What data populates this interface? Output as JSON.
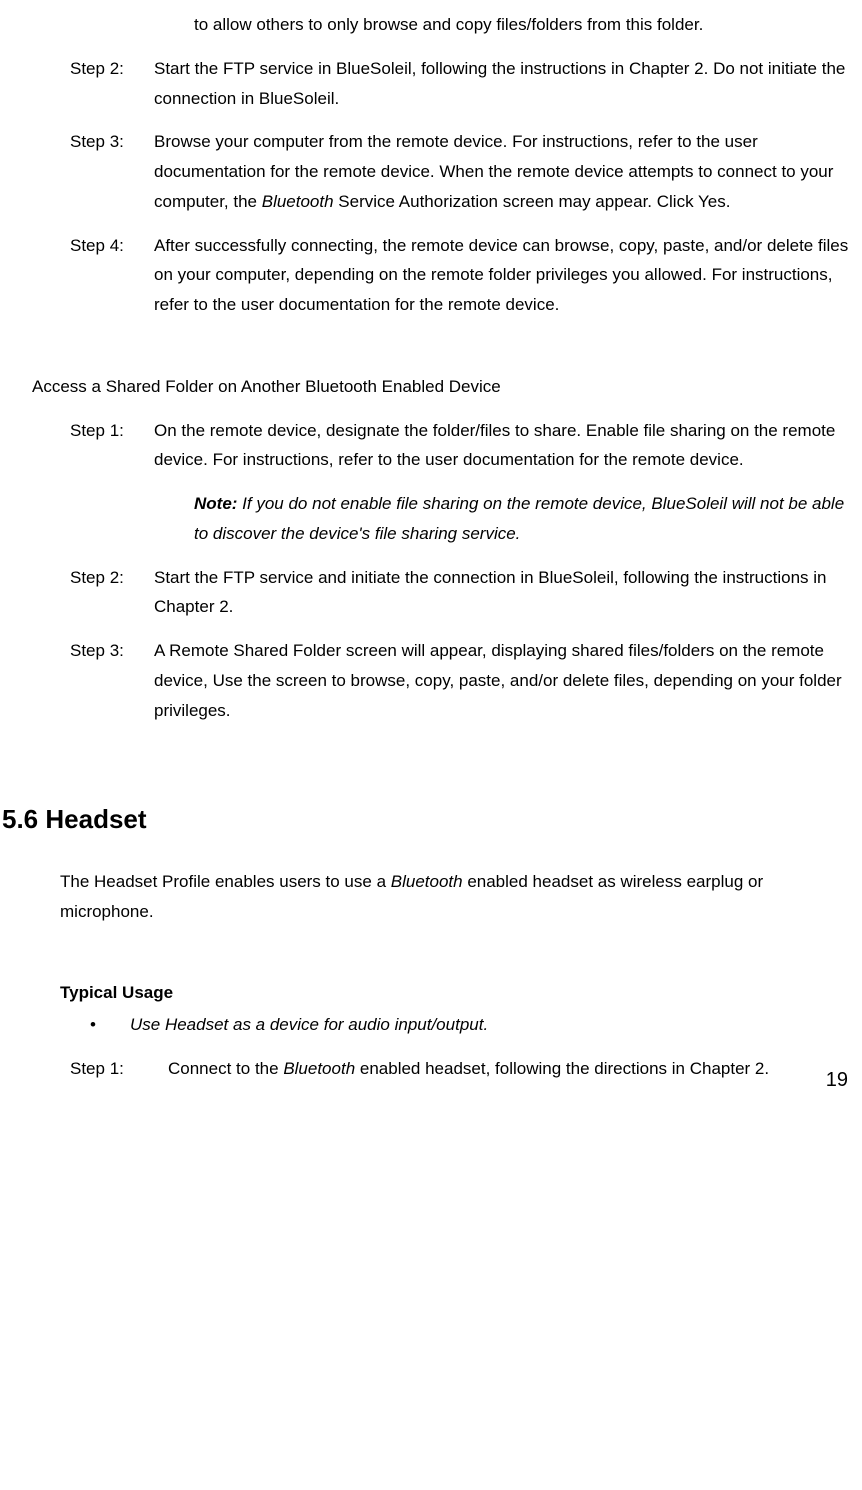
{
  "topSteps": {
    "continuation": "to allow others to only browse and copy files/folders from this folder.",
    "step2": {
      "label": "Step 2:",
      "body": "Start the FTP service in BlueSoleil, following the instructions in Chapter 2. Do not initiate the connection in BlueSoleil."
    },
    "step3": {
      "label": "Step 3:",
      "bodyPrefix": "Browse your computer from the remote device. For instructions, refer to the user documentation for the remote device. When the remote device attempts to connect to your computer, the ",
      "bluetoothWord": "Bluetooth",
      "bodySuffix": " Service Authorization screen may appear. Click Yes."
    },
    "step4": {
      "label": "Step 4:",
      "body": "After successfully connecting, the remote device can browse, copy, paste, and/or delete files on your computer, depending on the remote folder privileges you allowed. For instructions, refer to the user documentation for the remote device."
    }
  },
  "accessSection": {
    "title": "Access a Shared Folder on Another Bluetooth Enabled Device",
    "step1": {
      "label": "Step 1:",
      "body": "On the remote device, designate the folder/files to share. Enable file sharing on the remote device. For instructions, refer to the user documentation for the remote device.",
      "noteLabel": "Note:",
      "noteBody": " If you do not enable file sharing on the remote device, BlueSoleil will not be able to discover the device's file sharing service."
    },
    "step2": {
      "label": "Step 2:",
      "body": "Start the FTP service and initiate the connection in BlueSoleil, following the instructions in Chapter 2."
    },
    "step3": {
      "label": "Step 3:",
      "body": "A Remote Shared Folder screen will appear, displaying shared files/folders on the remote device, Use the screen to browse, copy, paste, and/or delete files, depending on your folder privileges."
    }
  },
  "headsetSection": {
    "heading": "5.6 Headset",
    "introPrefix": "The Headset Profile enables users to use a ",
    "bluetoothWord": "Bluetooth",
    "introSuffix": " enabled headset as wireless earplug or microphone.",
    "typicalUsage": "Typical Usage",
    "bullet": "Use Headset as a device for audio input/output.",
    "bulletDot": "•",
    "step1": {
      "label": "Step 1:",
      "bodyPrefix": "Connect to the ",
      "bluetoothWord": "Bluetooth",
      "bodySuffix": " enabled headset, following the directions in Chapter 2."
    }
  },
  "pageNumber": "19"
}
